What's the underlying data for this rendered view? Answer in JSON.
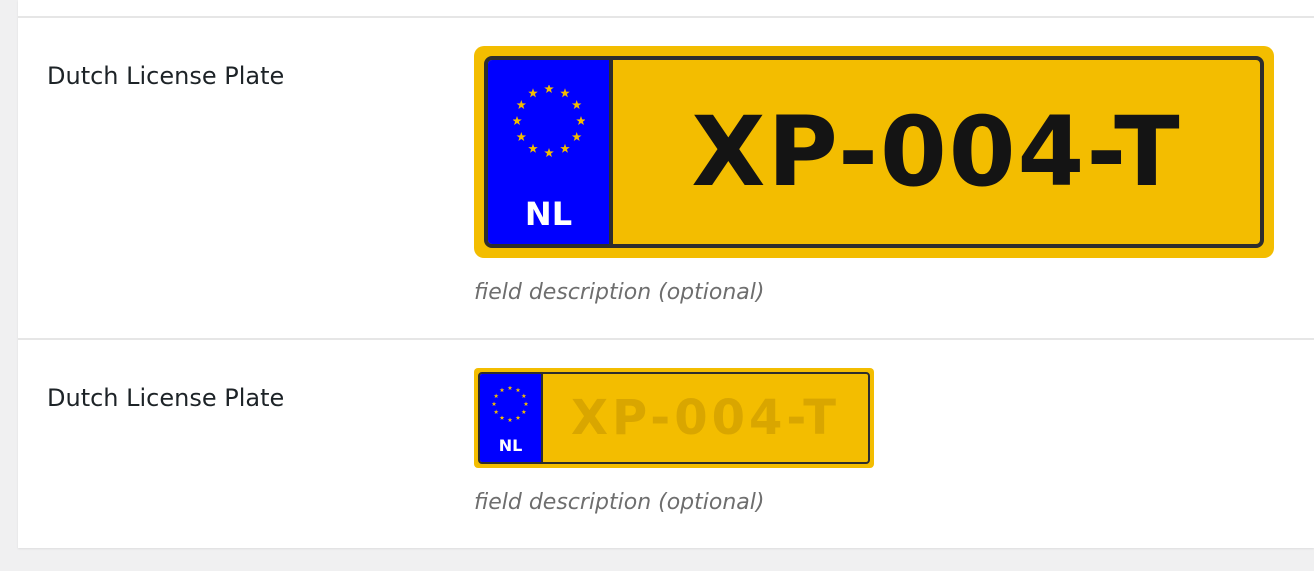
{
  "colors": {
    "plate_yellow": "#f3bd00",
    "eu_blue": "#0000ff",
    "star_yellow": "#f3bd00",
    "plate_border": "#2d2d2d",
    "placeholder_text": "#d9a600"
  },
  "fields": [
    {
      "label": "Dutch License Plate",
      "country_code": "NL",
      "value": "XP-004-T",
      "placeholder": "",
      "description": "field description (optional)",
      "size": "large"
    },
    {
      "label": "Dutch License Plate",
      "country_code": "NL",
      "value": "",
      "placeholder": "XP-004-T",
      "description": "field description (optional)",
      "size": "small"
    }
  ],
  "icons": {
    "eu_emblem": "eu-stars-icon"
  }
}
